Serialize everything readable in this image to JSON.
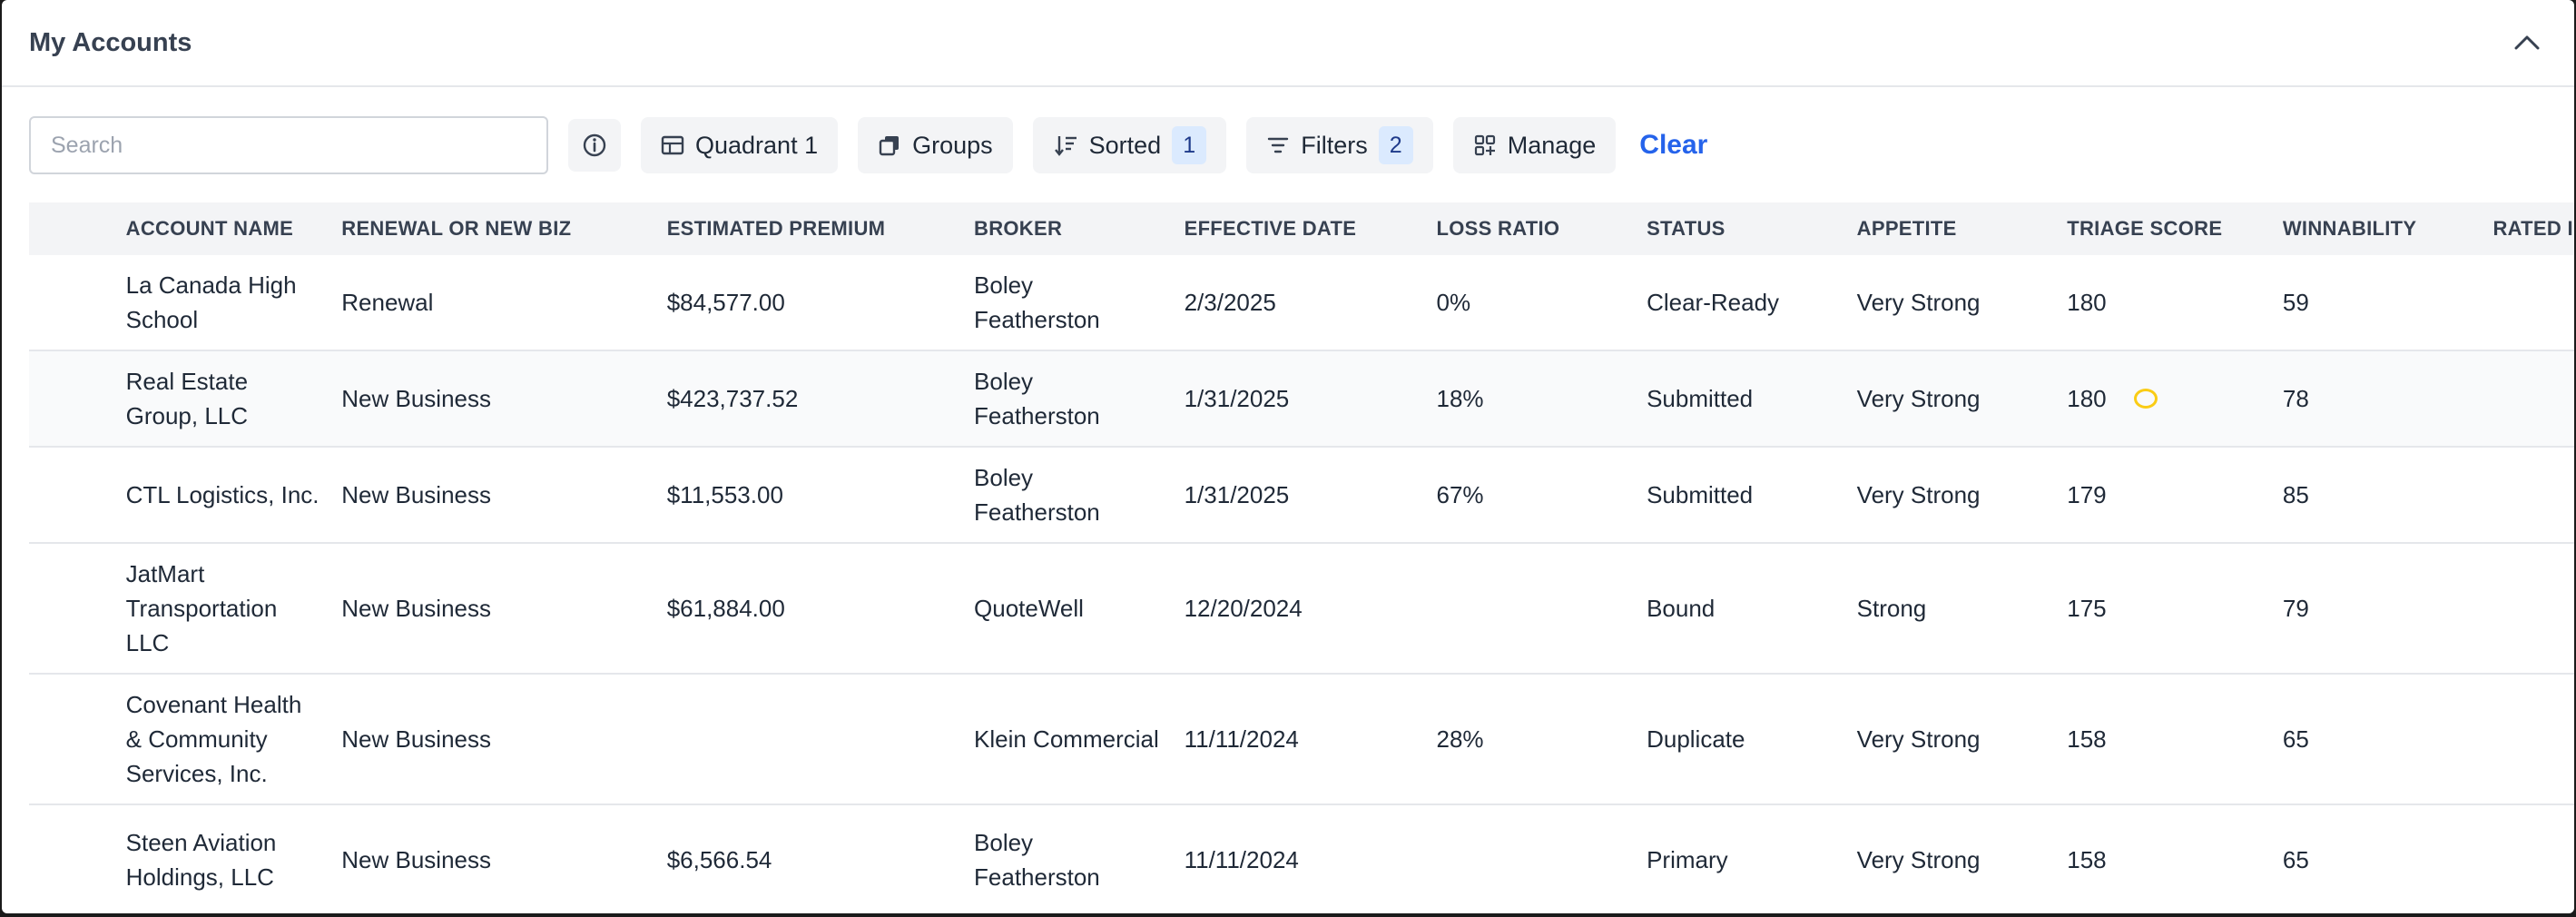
{
  "panel": {
    "title": "My Accounts"
  },
  "toolbar": {
    "search_placeholder": "Search",
    "quadrant_label": "Quadrant 1",
    "groups_label": "Groups",
    "sorted_label": "Sorted",
    "sorted_count": "1",
    "filters_label": "Filters",
    "filters_count": "2",
    "manage_label": "Manage",
    "clear_label": "Clear"
  },
  "table": {
    "columns": [
      "ACCOUNT NAME",
      "RENEWAL OR NEW BIZ",
      "ESTIMATED PREMIUM",
      "BROKER",
      "EFFECTIVE DATE",
      "LOSS RATIO",
      "STATUS",
      "APPETITE",
      "TRIAGE SCORE",
      "WINNABILITY",
      "RATED I"
    ],
    "rows": [
      {
        "name": "La Canada High School",
        "biz": "Renewal",
        "premium": "$84,577.00",
        "broker": "Boley Featherston",
        "date": "2/3/2025",
        "loss": "0%",
        "status": "Clear-Ready",
        "appetite": "Very Strong",
        "score": "180",
        "win": "59"
      },
      {
        "name": "Real Estate Group, LLC",
        "biz": "New Business",
        "premium": "$423,737.52",
        "broker": "Boley Featherston",
        "date": "1/31/2025",
        "loss": "18%",
        "status": "Submitted",
        "appetite": "Very Strong",
        "score": "180",
        "win": "78"
      },
      {
        "name": "CTL Logistics, Inc.",
        "biz": "New Business",
        "premium": "$11,553.00",
        "broker": "Boley Featherston",
        "date": "1/31/2025",
        "loss": "67%",
        "status": "Submitted",
        "appetite": "Very Strong",
        "score": "179",
        "win": "85"
      },
      {
        "name": "JatMart Transportation LLC",
        "biz": "New Business",
        "premium": "$61,884.00",
        "broker": "QuoteWell",
        "date": "12/20/2024",
        "loss": "",
        "status": "Bound",
        "appetite": "Strong",
        "score": "175",
        "win": "79"
      },
      {
        "name": "Covenant Health & Community Services, Inc.",
        "biz": "New Business",
        "premium": "",
        "broker": "Klein Commercial",
        "date": "11/11/2024",
        "loss": "28%",
        "status": "Duplicate",
        "appetite": "Very Strong",
        "score": "158",
        "win": "65"
      },
      {
        "name": "Steen Aviation Holdings, LLC",
        "biz": "New Business",
        "premium": "$6,566.54",
        "broker": "Boley Featherston",
        "date": "11/11/2024",
        "loss": "",
        "status": "Primary",
        "appetite": "Very Strong",
        "score": "158",
        "win": "65"
      }
    ]
  },
  "colors": {
    "accent": "#2563eb",
    "badge_bg": "#dbeafe",
    "header_bg": "#f3f4f6",
    "marker": "#facc15"
  }
}
